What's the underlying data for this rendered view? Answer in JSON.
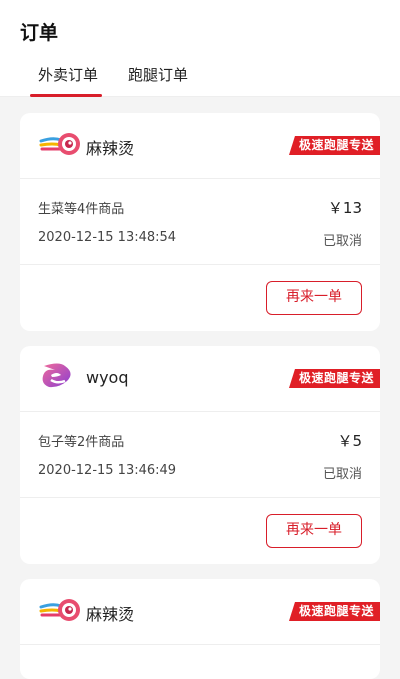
{
  "header": {
    "title": "订单"
  },
  "tabs": [
    {
      "label": "外卖订单",
      "active": true
    },
    {
      "label": "跑腿订单",
      "active": false
    }
  ],
  "colors": {
    "accent": "#d81e2a",
    "badge": "#e01f26"
  },
  "orders": [
    {
      "shop_name": "麻辣烫",
      "logo": "snail-logo-icon",
      "badge": "极速跑腿专送",
      "goods": "生菜等4件商品",
      "price": "￥13",
      "time": "2020-12-15 13:48:54",
      "status": "已取消",
      "action": "再来一单"
    },
    {
      "shop_name": "wyoq",
      "logo": "e-letter-logo-icon",
      "badge": "极速跑腿专送",
      "goods": "包子等2件商品",
      "price": "￥5",
      "time": "2020-12-15 13:46:49",
      "status": "已取消",
      "action": "再来一单"
    },
    {
      "shop_name": "麻辣烫",
      "logo": "snail-logo-icon",
      "badge": "极速跑腿专送"
    }
  ]
}
